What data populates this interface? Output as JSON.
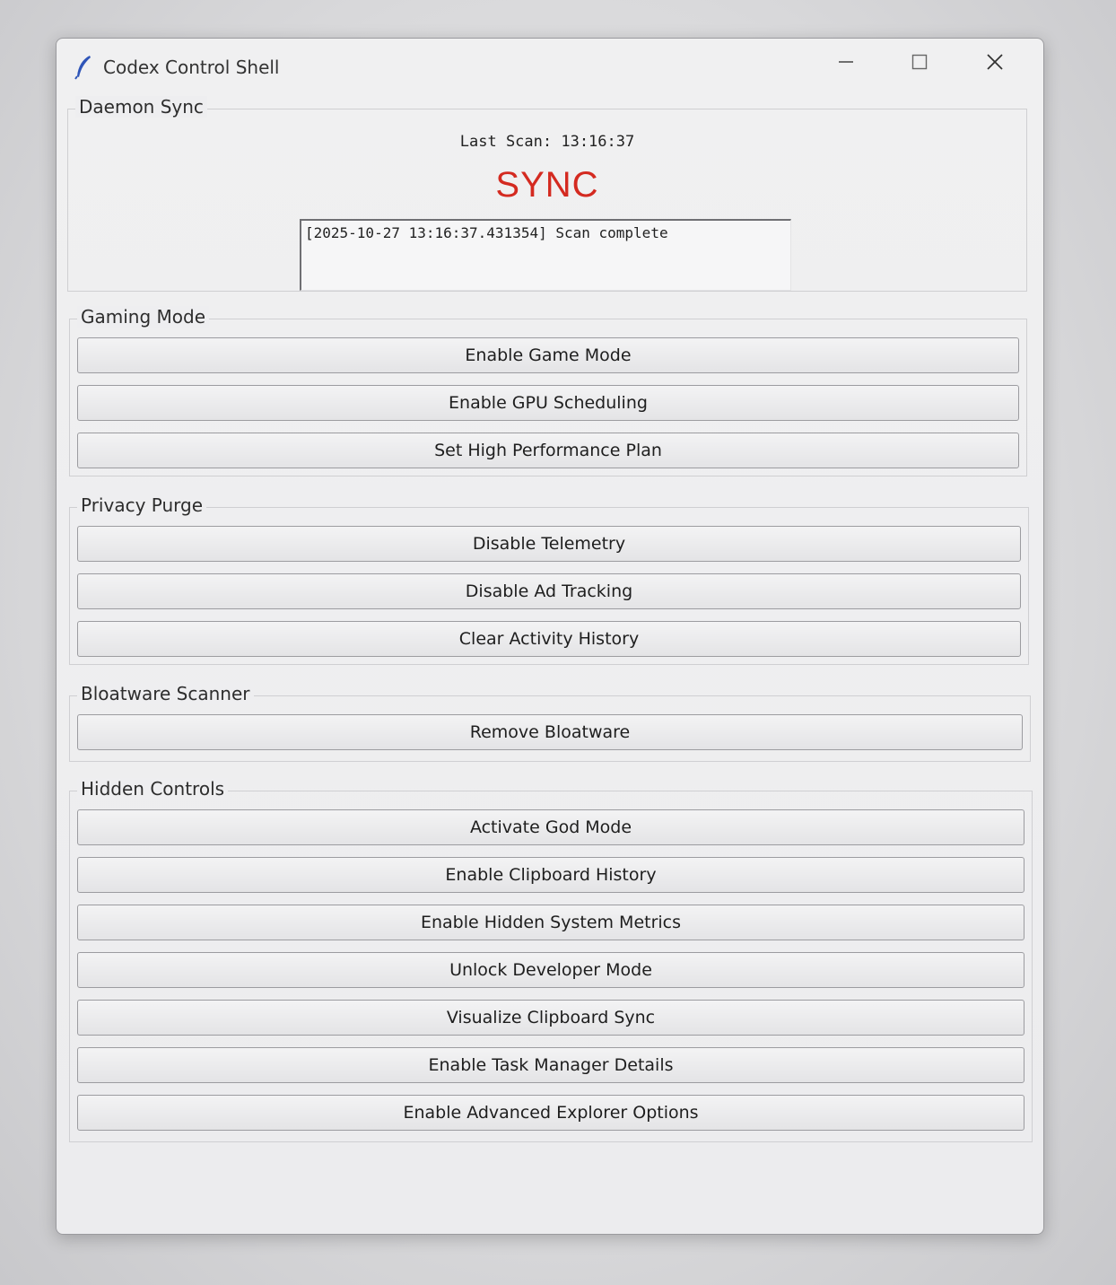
{
  "window": {
    "title": "Codex Control Shell"
  },
  "daemon_sync": {
    "label": "Daemon Sync",
    "last_scan": "Last Scan: 13:16:37",
    "status": "SYNC",
    "status_color": "#d42a20",
    "log": "[2025-10-27 13:16:37.431354] Scan complete"
  },
  "gaming_mode": {
    "label": "Gaming Mode",
    "buttons": [
      "Enable Game Mode",
      "Enable GPU Scheduling",
      "Set High Performance Plan"
    ]
  },
  "privacy_purge": {
    "label": "Privacy Purge",
    "buttons": [
      "Disable Telemetry",
      "Disable Ad Tracking",
      "Clear Activity History"
    ]
  },
  "bloatware_scanner": {
    "label": "Bloatware Scanner",
    "buttons": [
      "Remove Bloatware"
    ]
  },
  "hidden_controls": {
    "label": "Hidden Controls",
    "buttons": [
      "Activate God Mode",
      "Enable Clipboard History",
      "Enable Hidden System Metrics",
      "Unlock Developer Mode",
      "Visualize Clipboard Sync",
      "Enable Task Manager Details",
      "Enable Advanced Explorer Options"
    ]
  }
}
